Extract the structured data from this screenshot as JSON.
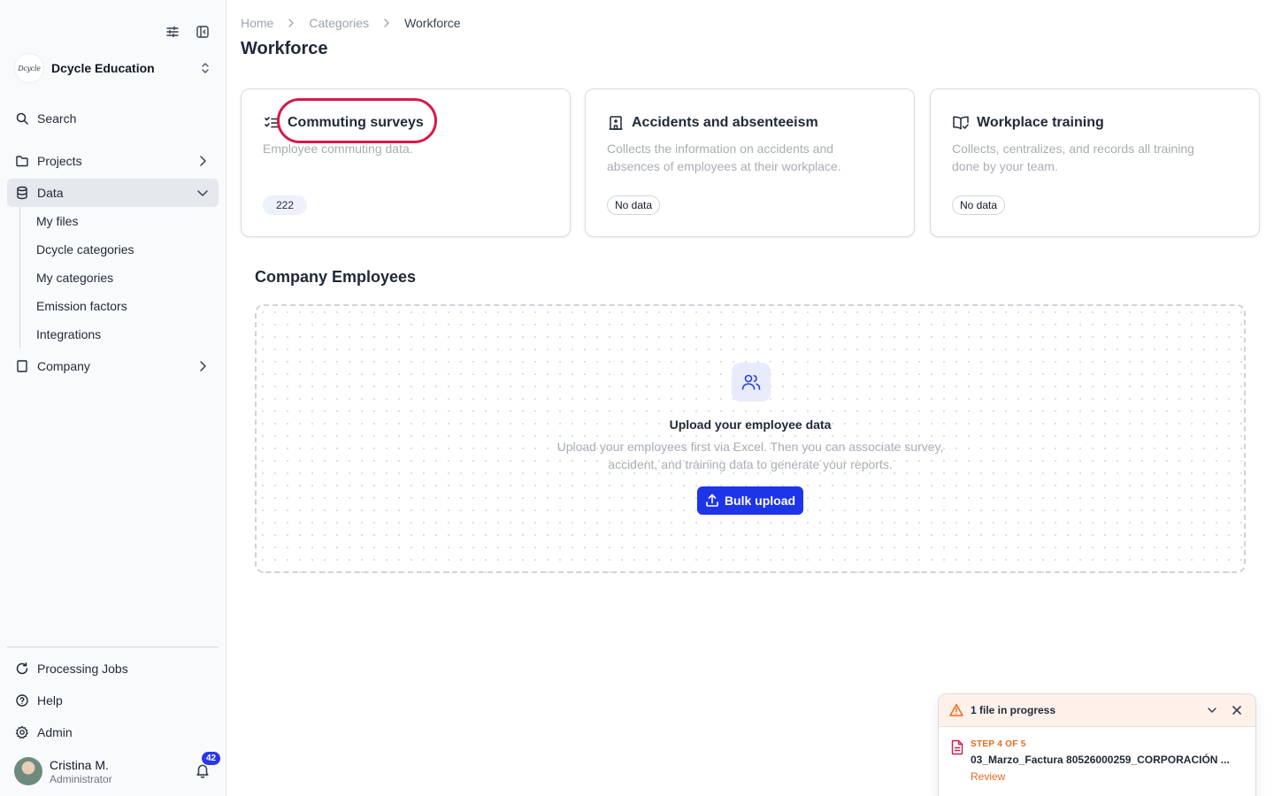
{
  "sidebar": {
    "org": {
      "logo_text": "Dcycle",
      "name": "Dcycle Education"
    },
    "search_label": "Search",
    "nav": {
      "projects": "Projects",
      "data": "Data",
      "company": "Company"
    },
    "data_subitems": [
      "My files",
      "Dcycle categories",
      "My categories",
      "Emission factors",
      "Integrations"
    ],
    "bottom": {
      "processing_jobs": "Processing Jobs",
      "help": "Help",
      "admin": "Admin"
    },
    "user": {
      "name": "Cristina M.",
      "role": "Administrator",
      "notifications": "42"
    }
  },
  "breadcrumb": [
    "Home",
    "Categories",
    "Workforce"
  ],
  "page_title": "Workforce",
  "cards": [
    {
      "title": "Commuting surveys",
      "description": "Employee commuting data.",
      "badge": "222",
      "icon": "checklist-icon"
    },
    {
      "title": "Accidents and absenteeism",
      "description": "Collects the information on accidents and absences of employees at their workplace.",
      "badge": "No data",
      "icon": "building-icon"
    },
    {
      "title": "Workplace training",
      "description": "Collects, centralizes, and records all training done by your team.",
      "badge": "No data",
      "icon": "book-check-icon"
    }
  ],
  "employees": {
    "section_title": "Company Employees",
    "empty_title": "Upload your employee data",
    "empty_desc": "Upload your employees first via Excel. Then you can associate survey, accident, and training data to generate your reports.",
    "button": "Bulk upload"
  },
  "toast": {
    "title": "1 file in progress",
    "step": "STEP 4 OF 5",
    "file_name": "03_Marzo_Factura 80526000259_CORPORACIÓN ...",
    "action": "Review"
  },
  "colors": {
    "accent": "#1d35e6",
    "highlight": "#d6194b",
    "warning": "#ea6a1a"
  }
}
